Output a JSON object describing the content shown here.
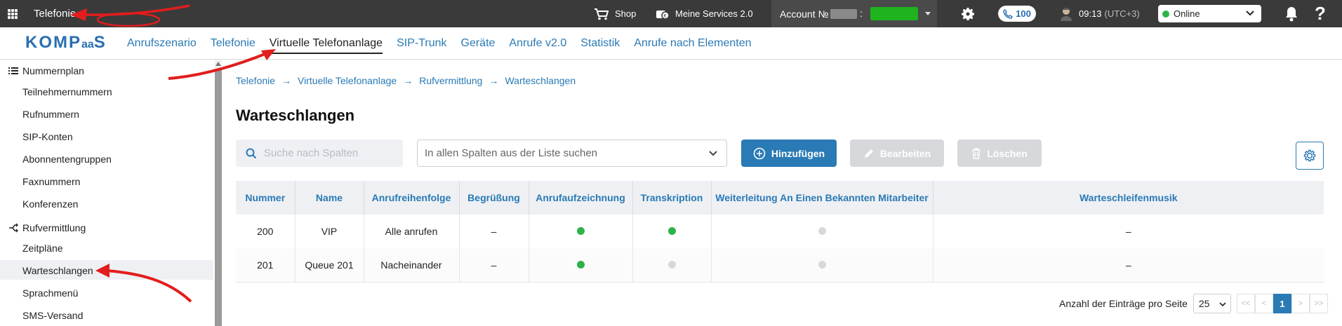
{
  "topbar": {
    "app_title": "Telefonie",
    "shop": "Shop",
    "services": "Meine Services 2.0",
    "account_label": "Account №",
    "account_colon": ":",
    "phone_count": "100",
    "time": "09:13",
    "timezone": "(UTC+3)",
    "status": "Online",
    "help": "?",
    "status_color": "#2db34a",
    "bar_color": "#3a3a3a"
  },
  "nav": {
    "logo_main": "KOMP",
    "logo_aa": "aa",
    "logo_end": "S",
    "links": [
      "Anrufszenario",
      "Telefonie",
      "Virtuelle Telefonanlage",
      "SIP-Trunk",
      "Geräte",
      "Anrufe v2.0",
      "Statistik",
      "Anrufe nach Elementen"
    ],
    "active_index": 2
  },
  "sidebar": {
    "group1": "Nummernplan",
    "items1": [
      "Teilnehmernummern",
      "Rufnummern",
      "SIP-Konten",
      "Abonnentengruppen",
      "Faxnummern",
      "Konferenzen"
    ],
    "group2": "Rufvermittlung",
    "items2": [
      "Zeitpläne",
      "Warteschlangen",
      "Sprachmenü",
      "SMS-Versand"
    ],
    "active_item": "Warteschlangen"
  },
  "breadcrumb": [
    "Telefonie",
    "Virtuelle Telefonanlage",
    "Rufvermittlung",
    "Warteschlangen"
  ],
  "page_title": "Warteschlangen",
  "toolbar": {
    "search_placeholder": "Suche nach Spalten",
    "column_select": "In allen Spalten aus der Liste suchen",
    "add": "Hinzufügen",
    "edit": "Bearbeiten",
    "delete": "Löschen"
  },
  "table": {
    "headers": [
      "Nummer",
      "Name",
      "Anrufreihenfolge",
      "Begrüßung",
      "Anrufaufzeichnung",
      "Transkription",
      "Weiterleitung An Einen Bekannten Mitarbeiter",
      "Warteschleifenmusik"
    ],
    "rows": [
      {
        "nummer": "200",
        "name": "VIP",
        "reihenfolge": "Alle anrufen",
        "begruessung": "–",
        "aufzeichnung": "on",
        "transkription": "on",
        "weiterleitung": "off",
        "musik": "–"
      },
      {
        "nummer": "201",
        "name": "Queue 201",
        "reihenfolge": "Nacheinander",
        "begruessung": "–",
        "aufzeichnung": "on",
        "transkription": "off",
        "weiterleitung": "off",
        "musik": "–"
      }
    ]
  },
  "pagination": {
    "label": "Anzahl der Einträge pro Seite",
    "per_page": "25",
    "first": "<<",
    "prev": "<",
    "current": "1",
    "next": ">",
    "last": ">>"
  }
}
